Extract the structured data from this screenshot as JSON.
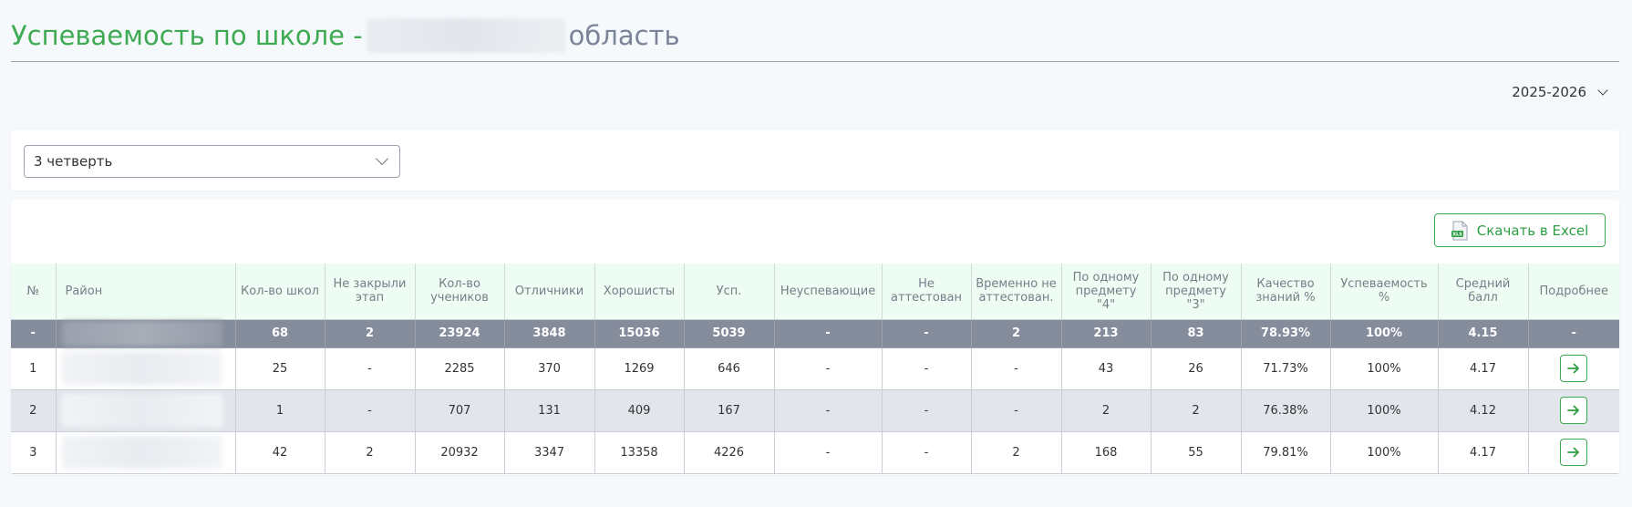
{
  "header": {
    "title": "Успеваемость по школе -",
    "title_suffix": "область"
  },
  "year_select": {
    "value": "2025-2026"
  },
  "filter": {
    "quarter_value": "3 четверть"
  },
  "toolbar": {
    "excel_label": "Скачать в Excel",
    "excel_icon": "xls-file-icon",
    "excel_icon_text": "XLS"
  },
  "table": {
    "columns": [
      "№",
      "Район",
      "Кол-во школ",
      "Не закрыли этап",
      "Кол-во учеников",
      "Отличники",
      "Хорошисты",
      "Усп.",
      "Неуспевающие",
      "Не аттестован",
      "Временно не аттестован.",
      "По одному предмету \"4\"",
      "По одному предмету \"3\"",
      "Качество знаний %",
      "Успеваемость %",
      "Средний балл",
      "Подробнее"
    ],
    "total": [
      "-",
      "68",
      "2",
      "23924",
      "3848",
      "15036",
      "5039",
      "-",
      "-",
      "2",
      "213",
      "83",
      "78.93%",
      "100%",
      "4.15",
      "-"
    ],
    "rows": [
      [
        "1",
        "25",
        "-",
        "2285",
        "370",
        "1269",
        "646",
        "-",
        "-",
        "-",
        "43",
        "26",
        "71.73%",
        "100%",
        "4.17"
      ],
      [
        "2",
        "1",
        "-",
        "707",
        "131",
        "409",
        "167",
        "-",
        "-",
        "-",
        "2",
        "2",
        "76.38%",
        "100%",
        "4.12"
      ],
      [
        "3",
        "42",
        "2",
        "20932",
        "3347",
        "13358",
        "4226",
        "-",
        "-",
        "2",
        "168",
        "55",
        "79.81%",
        "100%",
        "4.17"
      ]
    ]
  },
  "colors": {
    "accent": "#3eaa52",
    "total_row": "#858c9c",
    "header_bg": "#eefdf3"
  }
}
